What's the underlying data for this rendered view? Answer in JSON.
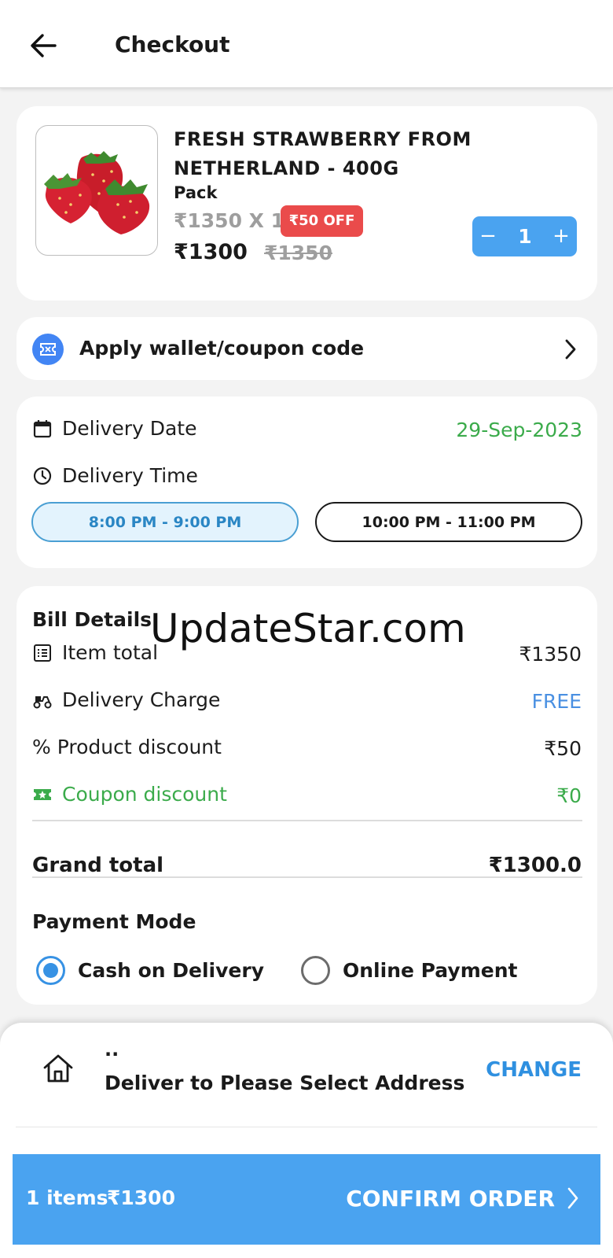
{
  "header": {
    "title": "Checkout"
  },
  "product": {
    "name": "FRESH STRAWBERRY FROM NETHERLAND - 400G",
    "unit": "Pack",
    "unit_price_line": "₹1350 X 1",
    "discount_badge": "₹50 OFF",
    "final_price": "₹1300",
    "original_price": "₹1350",
    "quantity": "1",
    "minus_label": "−",
    "plus_label": "+"
  },
  "coupon": {
    "label": "Apply wallet/coupon code"
  },
  "delivery": {
    "date_label": "Delivery Date",
    "date_value": "29-Sep-2023",
    "time_label": "Delivery Time",
    "slots": [
      {
        "label": "8:00 PM - 9:00 PM",
        "selected": true
      },
      {
        "label": "10:00 PM - 11:00 PM",
        "selected": false
      }
    ]
  },
  "bill": {
    "title": "Bill Details",
    "watermark": "UpdateStar.com",
    "item_total_label": "Item total",
    "item_total_value": "₹1350",
    "delivery_charge_label": "Delivery Charge",
    "delivery_charge_value": "FREE",
    "product_discount_label": "% Product discount",
    "product_discount_value": "₹50",
    "coupon_discount_label": "Coupon discount",
    "coupon_discount_value": "₹0",
    "grand_total_label": "Grand total",
    "grand_total_value": "₹1300.0"
  },
  "payment": {
    "title": "Payment Mode",
    "options": [
      {
        "label": "Cash on Delivery",
        "selected": true
      },
      {
        "label": "Online Payment",
        "selected": false
      }
    ]
  },
  "address": {
    "name": "..",
    "text": "Deliver to Please Select Address",
    "change_label": "CHANGE"
  },
  "footer": {
    "item_count": "1 items",
    "total": "₹1300",
    "confirm_label": "CONFIRM ORDER"
  },
  "colors": {
    "primary_blue": "#4aa3f0",
    "green": "#3bab4b",
    "badge_red": "#ea4b4b",
    "link_blue": "#2f90e0"
  }
}
